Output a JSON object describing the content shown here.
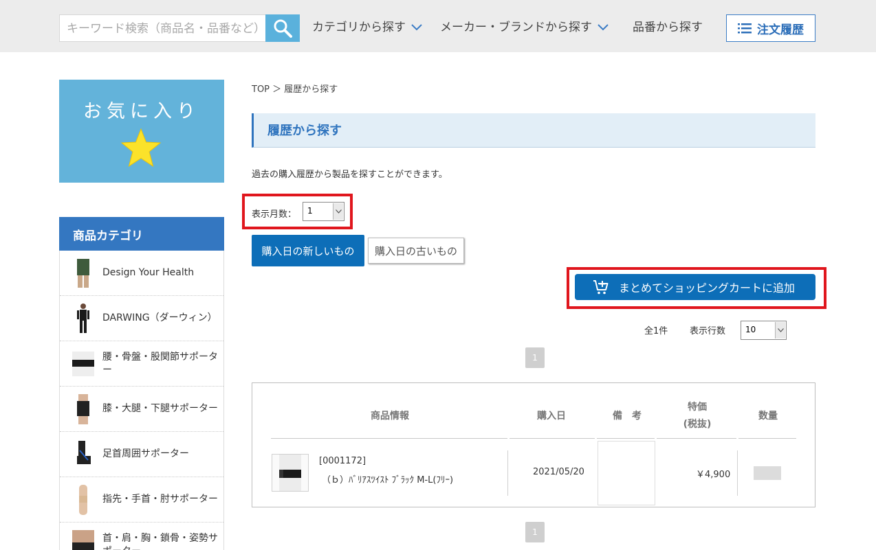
{
  "header": {
    "search_placeholder": "キーワード検索（商品名・品番など）",
    "nav_category": "カテゴリから探す",
    "nav_brand": "メーカー・ブランドから探す",
    "nav_part_number": "品番から探す",
    "order_history": "注文履歴"
  },
  "sidebar": {
    "favorites_title": "お気に入り",
    "category_heading": "商品カテゴリ",
    "categories": [
      {
        "label": "Design Your Health"
      },
      {
        "label": "DARWING（ダーウィン）"
      },
      {
        "label": "腰・骨盤・股関節サポーター"
      },
      {
        "label": "膝・大腿・下腿サポーター"
      },
      {
        "label": "足首周囲サポーター"
      },
      {
        "label": "指先・手首・肘サポーター"
      },
      {
        "label": "首・肩・胸・鎖骨・姿勢サポーター"
      }
    ]
  },
  "main": {
    "breadcrumb": "TOP ＞ 履歴から探す",
    "title": "履歴から探す",
    "description": "過去の購入履歴から製品を探すことができます。",
    "months_label": "表示月数：",
    "months_value": "1",
    "sort_newest": "購入日の新しいもの",
    "sort_oldest": "購入日の古いもの",
    "add_to_cart": "まとめてショッピングカートに追加",
    "total_count": "全1件",
    "rows_label": "表示行数",
    "rows_value": "10",
    "page_number": "1"
  },
  "table": {
    "headers": {
      "product_info": "商品情報",
      "purchase_date": "購入日",
      "remarks": "備　考",
      "special_price_1": "特価",
      "special_price_2": "(税抜)",
      "quantity": "数量"
    },
    "rows": [
      {
        "code": "[0001172]",
        "name": "（ｂ）ﾊﾞﾘｱｽﾂｲｽﾄ ﾌﾞﾗｯｸ M-L(ﾌﾘｰ)",
        "date": "2021/05/20",
        "price": "￥4,900"
      }
    ]
  },
  "colors": {
    "accent_blue": "#0d6eb8",
    "highlight_red": "#e0161d",
    "favorites_bg": "#63b3da"
  }
}
